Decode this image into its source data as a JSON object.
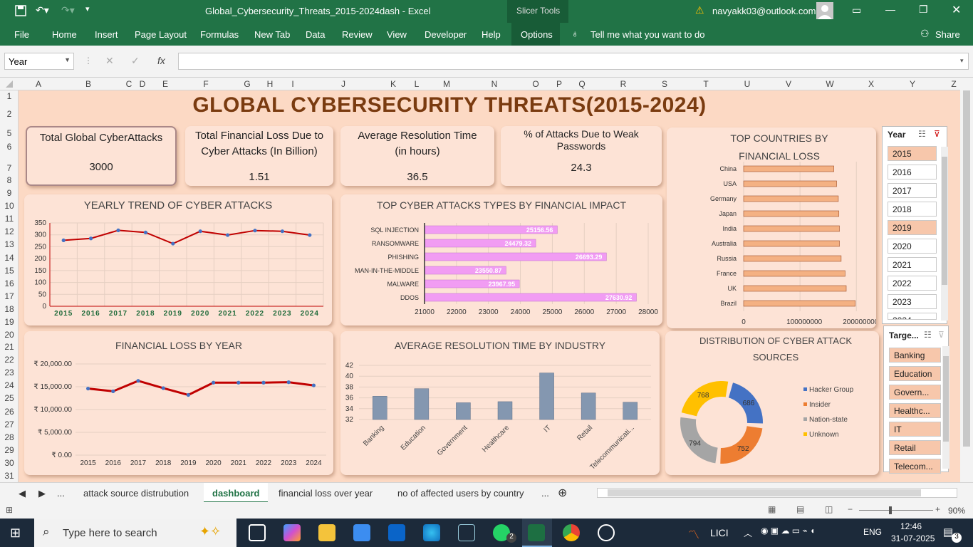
{
  "titlebar": {
    "file_title": "Global_Cybersecurity_Threats_2015-2024dash  -  Excel",
    "context": "Slicer Tools",
    "account": "navyakk03@outlook.com"
  },
  "ribbon": {
    "tabs": [
      "File",
      "Home",
      "Insert",
      "Page Layout",
      "Formulas",
      "New Tab",
      "Data",
      "Review",
      "View",
      "Developer",
      "Help",
      "Options"
    ],
    "tell_me": "Tell me what you want to do",
    "share": "Share"
  },
  "formula_bar": {
    "name_box": "Year",
    "fx": "fx",
    "value": ""
  },
  "columns": [
    "A",
    "B",
    "C",
    "D",
    "E",
    "F",
    "G",
    "H",
    "I",
    "J",
    "K",
    "L",
    "M",
    "N",
    "O",
    "P",
    "Q",
    "R",
    "S",
    "T",
    "U",
    "V",
    "W",
    "X",
    "Y",
    "Z"
  ],
  "rows": [
    "1",
    "2",
    "5",
    "6",
    "7",
    "8",
    "9",
    "10",
    "11",
    "12",
    "13",
    "14",
    "15",
    "16",
    "17",
    "18",
    "19",
    "20",
    "21",
    "22",
    "23",
    "24",
    "25",
    "26",
    "27",
    "28",
    "29",
    "30",
    "31"
  ],
  "dashboard": {
    "title": "GLOBAL CYBERSECURITY THREATS(2015-2024)",
    "kpis": [
      {
        "title": "Total  Global  CyberAttacks",
        "value": "3000"
      },
      {
        "title": "Total Financial Loss Due to Cyber Attacks (In Billion)",
        "value": "1.51"
      },
      {
        "title": "Average Resolution Time (in hours)",
        "value": "36.5"
      },
      {
        "title": "% of Attacks Due to Weak Passwords",
        "value": "24.3"
      }
    ]
  },
  "chart_data": [
    {
      "type": "line",
      "title": "YEARLY TREND OF CYBER ATTACKS",
      "x": [
        "2015",
        "2016",
        "2017",
        "2018",
        "2019",
        "2020",
        "2021",
        "2022",
        "2023",
        "2024"
      ],
      "values": [
        277,
        285,
        319,
        310,
        263,
        315,
        299,
        318,
        315,
        299
      ],
      "ylim": [
        0,
        350
      ],
      "yticks": [
        "0",
        "50",
        "100",
        "150",
        "200",
        "250",
        "300",
        "350"
      ],
      "color": "#c00000"
    },
    {
      "type": "bar",
      "orientation": "horizontal",
      "title": "TOP CYBER ATTACKS TYPES BY FINANCIAL IMPACT",
      "categories": [
        "SQL INJECTION",
        "RANSOMWARE",
        "PHISHING",
        "MAN-IN-THE-MIDDLE",
        "MALWARE",
        "DDOS"
      ],
      "values": [
        25156.56,
        24479.32,
        26693.29,
        23550.87,
        23967.95,
        27630.92
      ],
      "labels": [
        "25156.56",
        "24479.32",
        "26693.29",
        "23550.87",
        "23967.95",
        "27630.92"
      ],
      "xlim": [
        21000,
        28000
      ],
      "xticks": [
        "21000",
        "22000",
        "23000",
        "24000",
        "25000",
        "26000",
        "27000",
        "28000"
      ],
      "color": "#f19cf3"
    },
    {
      "type": "bar",
      "orientation": "horizontal",
      "title": "TOP COUNTRIES BY FINANCIAL LOSS",
      "categories": [
        "China",
        "USA",
        "Germany",
        "Japan",
        "India",
        "Australia",
        "Russia",
        "France",
        "UK",
        "Brazil"
      ],
      "values": [
        160000000,
        165000000,
        168000000,
        169000000,
        170000000,
        170000000,
        173000000,
        180000000,
        182000000,
        198000000
      ],
      "xlim": [
        0,
        230000000
      ],
      "xticks": [
        "0",
        "100000000",
        "200000000"
      ],
      "color": "#f4b183"
    },
    {
      "type": "line",
      "title": "FINANCIAL LOSS BY YEAR",
      "x": [
        "2015",
        "2016",
        "2017",
        "2018",
        "2019",
        "2020",
        "2021",
        "2022",
        "2023",
        "2024"
      ],
      "values": [
        14600,
        14000,
        16300,
        14700,
        13200,
        15900,
        15900,
        15900,
        16000,
        15300
      ],
      "ylim": [
        0,
        20000
      ],
      "yticks": [
        "₹ 0.00",
        "₹ 5,000.00",
        "₹ 10,000.00",
        "₹ 15,000.00",
        "₹ 20,000.00"
      ],
      "color": "#c00000"
    },
    {
      "type": "bar",
      "title": "AVERAGE RESOLUTION TIME BY INDUSTRY",
      "categories": [
        "Banking",
        "Education",
        "Government",
        "Healthcare",
        "IT",
        "Retail",
        "Telecommunicati..."
      ],
      "values": [
        36.3,
        37.7,
        35.1,
        35.3,
        40.6,
        36.9,
        35.2
      ],
      "ylim": [
        32,
        42
      ],
      "yticks": [
        "32",
        "34",
        "36",
        "38",
        "40",
        "42"
      ],
      "color": "#8497b0"
    },
    {
      "type": "pie",
      "title": "DISTRIBUTION OF CYBER ATTACK SOURCES",
      "categories": [
        "Hacker Group",
        "Insider",
        "Nation-state",
        "Unknown"
      ],
      "values": [
        686,
        752,
        794,
        768
      ],
      "labels": [
        "686",
        "752",
        "794",
        "768"
      ],
      "colors": [
        "#4472c4",
        "#ed7d31",
        "#a5a5a5",
        "#ffc000"
      ]
    }
  ],
  "slicers": {
    "year": {
      "title": "Year",
      "items": [
        "2015",
        "2016",
        "2017",
        "2018",
        "2019",
        "2020",
        "2021",
        "2022",
        "2023",
        "2024"
      ],
      "selected": [
        "2015",
        "2019"
      ]
    },
    "target": {
      "title": "Targe...",
      "items": [
        "Banking",
        "Education",
        "Govern...",
        "Healthc...",
        "IT",
        "Retail",
        "Telecom..."
      ]
    }
  },
  "sheet_tabs": {
    "items": [
      "attack source distrubution",
      "dashboard",
      "financial loss over year",
      "no of affected users by country"
    ],
    "active": "dashboard",
    "ellipsis": "..."
  },
  "status": {
    "zoom": "90%"
  },
  "taskbar": {
    "search": "Type here to search",
    "weather": "LICI",
    "lang": "ENG",
    "time": "12:46",
    "date": "31-07-2025",
    "whatsapp_badge": "2",
    "notif": "3"
  }
}
